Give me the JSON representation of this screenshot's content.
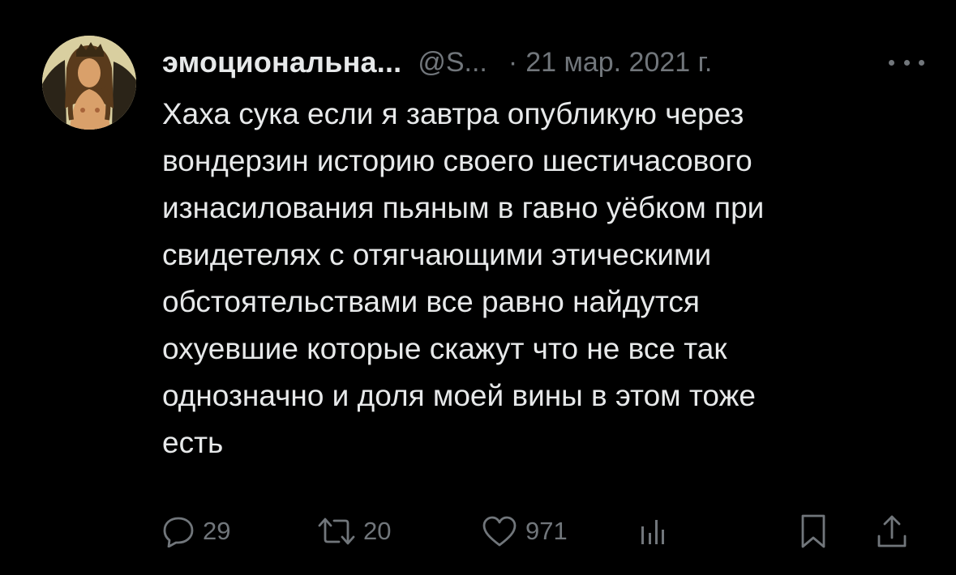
{
  "tweet": {
    "author": {
      "display_name": "эмоциональна...",
      "handle": "@S...",
      "avatar_icon": "avatar-portrait-drawing"
    },
    "separator": "·",
    "date": "21 мар. 2021 г.",
    "more_icon": "more-options-icon",
    "text_lines": [
      "Хаха сука если я завтра опубликую через",
      "вондерзин историю своего шестичасового",
      "изнасилования пьяным в гавно уёбком при",
      "свидетелях с отягчающими этическими",
      "обстоятельствами все равно найдутся",
      "охуевшие которые скажут что не все так",
      "однозначно и доля моей вины в этом тоже",
      "есть"
    ],
    "actions": {
      "reply": {
        "icon": "reply-icon",
        "count": "29"
      },
      "retweet": {
        "icon": "retweet-icon",
        "count": "20"
      },
      "like": {
        "icon": "like-icon",
        "count": "971"
      },
      "views": {
        "icon": "views-chart-icon"
      },
      "bookmark": {
        "icon": "bookmark-icon"
      },
      "share": {
        "icon": "share-icon"
      }
    }
  },
  "colors": {
    "background": "#000000",
    "primary_text": "#e7e9ea",
    "secondary_text": "#71767b"
  }
}
